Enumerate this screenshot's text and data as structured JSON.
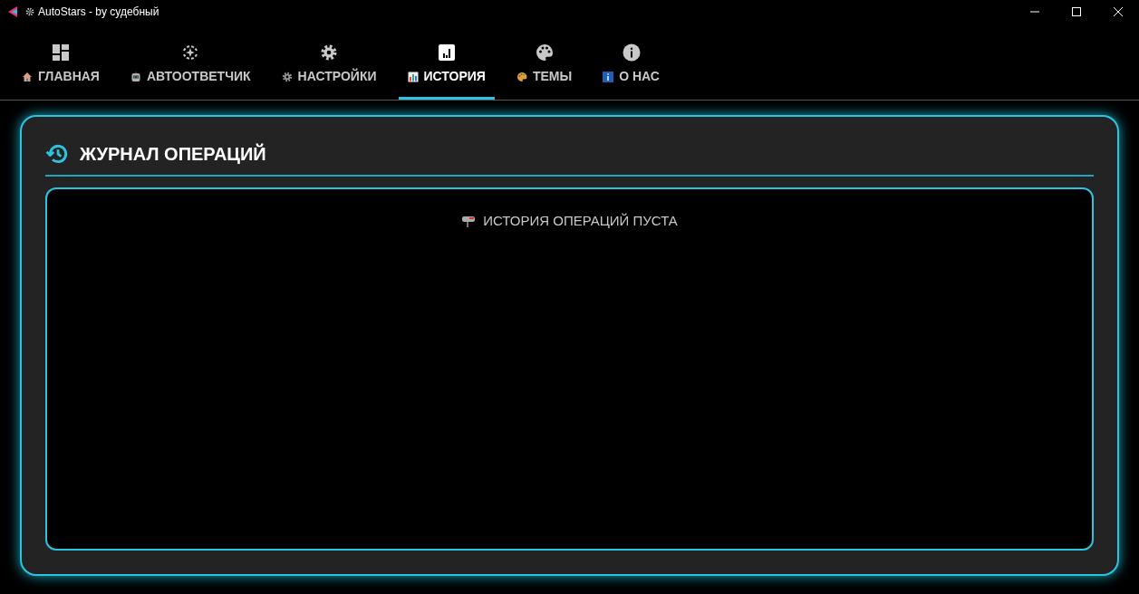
{
  "window": {
    "title": "AutoStars - by судебный"
  },
  "tabs": [
    {
      "label": "ГЛАВНАЯ",
      "kind": "home",
      "selected": false
    },
    {
      "label": "АВТООТВЕТЧИК",
      "kind": "bot",
      "selected": false
    },
    {
      "label": "НАСТРОЙКИ",
      "kind": "settings",
      "selected": false
    },
    {
      "label": "ИСТОРИЯ",
      "kind": "history",
      "selected": true
    },
    {
      "label": "ТЕМЫ",
      "kind": "themes",
      "selected": false
    },
    {
      "label": "О НАС",
      "kind": "about",
      "selected": false
    }
  ],
  "panel": {
    "title": "ЖУРНАЛ ОПЕРАЦИЙ",
    "empty_message": "ИСТОРИЯ ОПЕРАЦИЙ ПУСТА"
  }
}
